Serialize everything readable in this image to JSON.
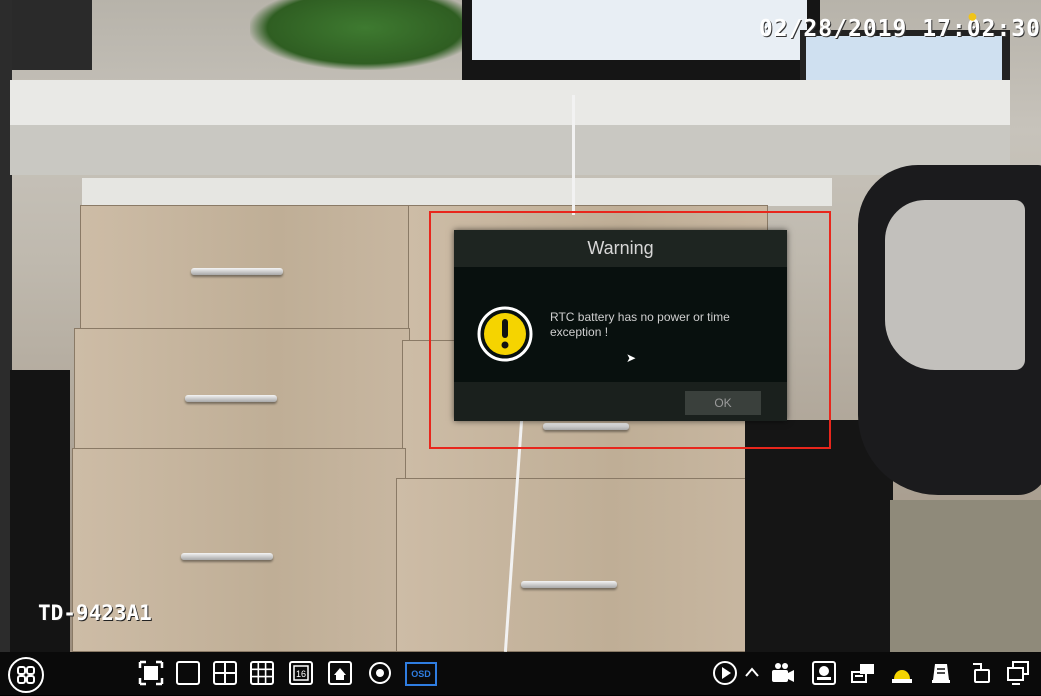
{
  "overlay": {
    "timestamp": "02/28/2019 17:02:30",
    "camera_name": "TD-9423A1"
  },
  "dialog": {
    "title": "Warning",
    "message": "RTC battery has no power or time exception !",
    "ok_label": "OK"
  },
  "toolbar": {
    "osd_label": "OSD",
    "layout_16_label": "16"
  },
  "colors": {
    "highlight_border": "#e8261c",
    "dialog_bg": "#0e1412",
    "warning_icon": "#f5d400",
    "osd_accent": "#2f7de0",
    "alarm_icon": "#f5d400"
  },
  "icons": [
    "menu-icon",
    "fullscreen-icon",
    "single-view-icon",
    "quad-view-icon",
    "nine-view-icon",
    "sixteen-view-icon",
    "sequence-icon",
    "image-adjust-icon",
    "playback-icon",
    "collapse-arrow-icon",
    "manual-record-icon",
    "manual-alarm-icon",
    "disk-icon",
    "alarm-icon",
    "status-icon",
    "lock-icon",
    "network-icon"
  ]
}
